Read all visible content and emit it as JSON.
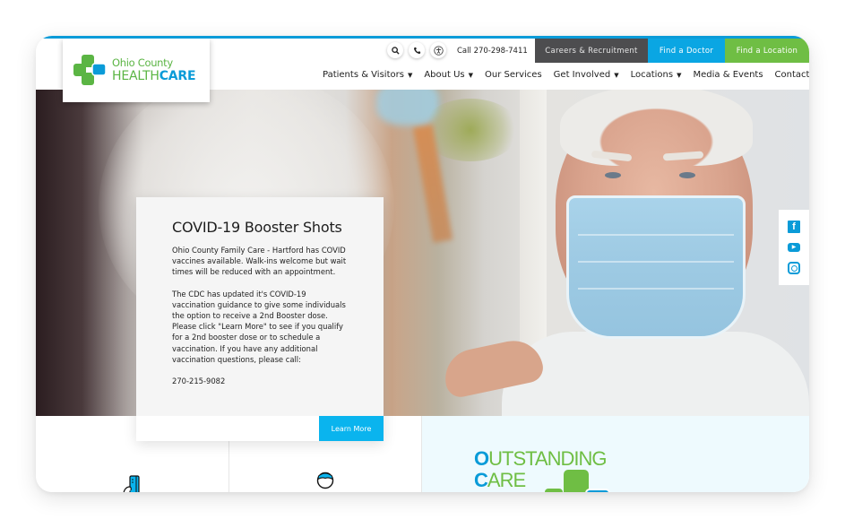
{
  "header": {
    "logo": {
      "line1": "Ohio County",
      "line2_part1": "HEALTH",
      "line2_part2": "CARE",
      "colors": {
        "green": "#5bb544",
        "blue": "#0a9bd8"
      }
    },
    "utility_icons": [
      {
        "name": "search-icon",
        "glyph": "⚲"
      },
      {
        "name": "phone-icon",
        "glyph": "✆"
      },
      {
        "name": "accessibility-icon",
        "glyph": "♿"
      }
    ],
    "call_text": "Call 270-298-7411",
    "top_buttons": [
      {
        "label": "Careers & Recruitment",
        "color": "#4d4d4f"
      },
      {
        "label": "Find a Doctor",
        "color": "#0aa6e3"
      },
      {
        "label": "Find a Location",
        "color": "#6fbe44"
      }
    ],
    "nav": [
      {
        "label": "Patients & Visitors",
        "dropdown": true
      },
      {
        "label": "About Us",
        "dropdown": true
      },
      {
        "label": "Our Services",
        "dropdown": false
      },
      {
        "label": "Get Involved",
        "dropdown": true
      },
      {
        "label": "Locations",
        "dropdown": true
      },
      {
        "label": "Media & Events",
        "dropdown": false
      },
      {
        "label": "Contact",
        "dropdown": false
      }
    ],
    "caret": "▼"
  },
  "hero": {
    "card": {
      "title": "COVID-19 Booster Shots",
      "paragraphs": [
        "Ohio County Family Care - Hartford has COVID vaccines available. Walk-ins welcome but wait times will be reduced with an appointment.",
        "The CDC has updated it's COVID-19 vaccination guidance to give some individuals the option to receive a 2nd Booster dose. Please click \"Learn More\" to see if you qualify for a 2nd booster dose or to schedule a vaccination. If you have any additional vaccination questions, please call:",
        "270-215-9082"
      ],
      "button_label": "Learn More",
      "button_color": "#0ab4ee"
    },
    "social": [
      {
        "name": "facebook-icon",
        "glyph": "f"
      },
      {
        "name": "youtube-icon",
        "glyph": "▶"
      },
      {
        "name": "instagram-icon",
        "glyph": ""
      }
    ]
  },
  "bottom": {
    "outstanding_care": {
      "line1_initial": "O",
      "line1_rest": "UTSTANDING",
      "line2_initial": "C",
      "line2_rest": "ARE"
    }
  },
  "colors": {
    "accent_blue": "#0a9bd8",
    "accent_green": "#6fbe44",
    "dark_gray": "#4d4d4f"
  }
}
